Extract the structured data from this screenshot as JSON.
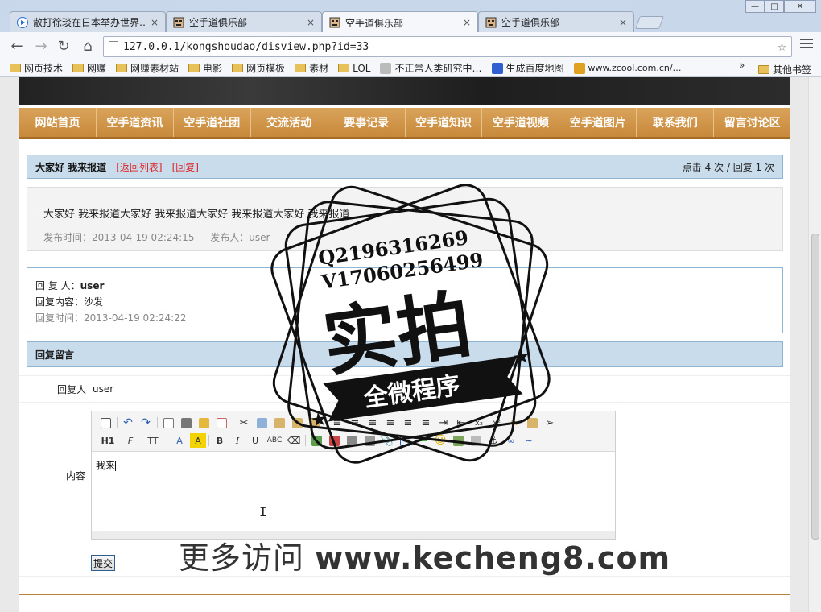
{
  "browser": {
    "tabs": [
      {
        "title": "散打徐琰在日本举办世界…",
        "close": "×"
      },
      {
        "title": "空手道俱乐部",
        "close": "×"
      },
      {
        "title": "空手道俱乐部",
        "close": "×"
      },
      {
        "title": "空手道俱乐部",
        "close": "×"
      }
    ],
    "active_tab": 2,
    "url": "127.0.0.1/kongshoudao/disview.php?id=33",
    "bookmarks": [
      "网页技术",
      "网赚",
      "网赚素材站",
      "电影",
      "网页模板",
      "素材",
      "LOL",
      "不正常人类研究中…",
      "生成百度地图",
      "www.zcool.com.cn/…"
    ],
    "bookmarks_more": "»",
    "bookmarks_other": "其他书签",
    "accent": "#c8893b"
  },
  "nav": {
    "items": [
      "网站首页",
      "空手道资讯",
      "空手道社团",
      "交流活动",
      "要事记录",
      "空手道知识",
      "空手道视频",
      "空手道图片",
      "联系我们",
      "留言讨论区"
    ]
  },
  "post": {
    "title": "大家好 我来报道",
    "back_link": "[返回列表]",
    "reply_link": "[回复]",
    "stats": "点击 4 次 / 回复 1 次",
    "content": "大家好 我来报道大家好 我来报道大家好 我来报道大家好 我来报道",
    "publish_time": "发布时间：2013-04-19 02:24:15",
    "publisher": "发布人：user"
  },
  "reply": {
    "replier_label": "回 复 人：",
    "replier": "user",
    "content_label": "回复内容：",
    "content": "沙发",
    "time": "回复时间：2013-04-19 02:24:22"
  },
  "form": {
    "section_title": "回复留言",
    "replier_label": "回复人",
    "replier_value": "user",
    "content_label": "内容",
    "editor_text": "我来",
    "submit_label": "提交",
    "editor_toolbar_row2": [
      "H1",
      "F",
      "TT",
      "A",
      "A",
      "B",
      "I",
      "U",
      "ABC"
    ]
  },
  "overlay": {
    "stamp_line1": "Q2196316269",
    "stamp_line2": "V17060256499",
    "stamp_big": "实拍",
    "stamp_ribbon": "全微程序",
    "watermark_prefix": "更多访问 ",
    "watermark_url": "www.kecheng8.com"
  }
}
